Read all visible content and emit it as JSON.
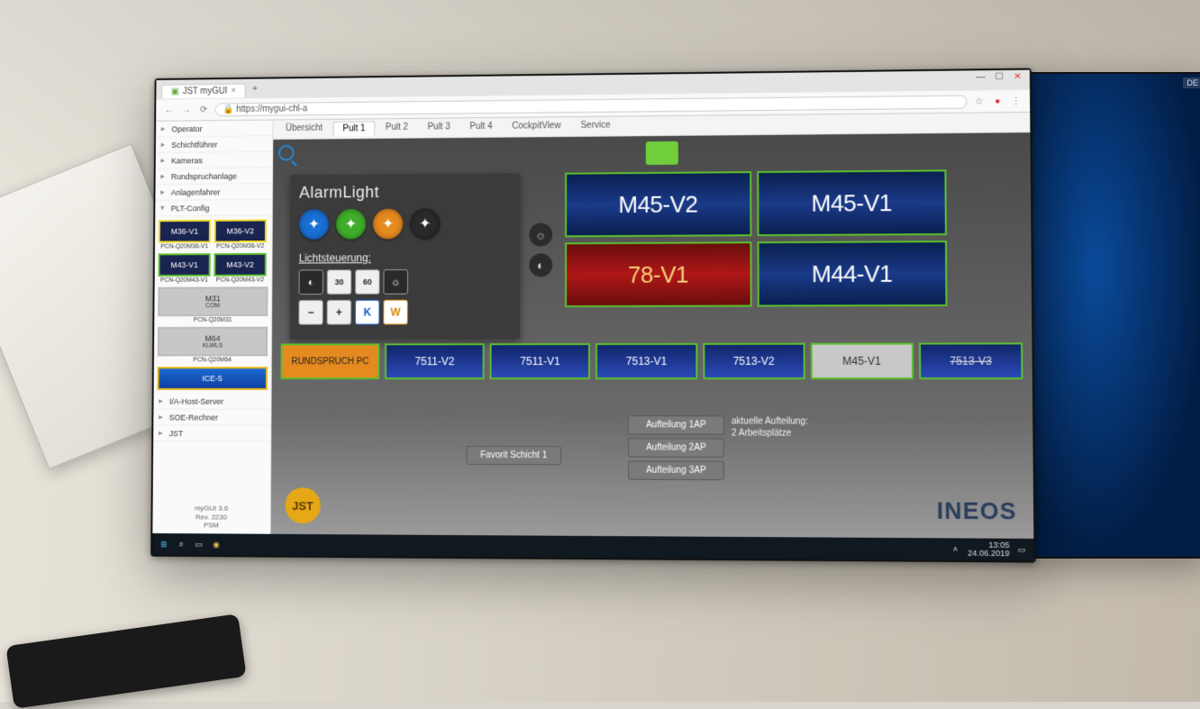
{
  "browser": {
    "tab_title": "JST myGUI",
    "url": "https://mygui-chl-a",
    "window_buttons": {
      "min": "—",
      "max": "☐",
      "close": "✕"
    }
  },
  "sidebar": {
    "items": [
      {
        "label": "Operator"
      },
      {
        "label": "Schichtführer"
      },
      {
        "label": "Kameras"
      },
      {
        "label": "Rundspruchanlage"
      },
      {
        "label": "Anlagenfahrer"
      },
      {
        "label": "PLT-Config"
      }
    ],
    "thumbs": [
      {
        "label": "M36-V1",
        "cap": "PCN-Q20M36-V1",
        "sel": true
      },
      {
        "label": "M36-V2",
        "cap": "PCN-Q20M36-V2",
        "sel": true
      },
      {
        "label": "M43-V1",
        "cap": "PCN-Q20M43-V1",
        "sel": false
      },
      {
        "label": "M43-V2",
        "cap": "PCN-Q20M43-V2",
        "sel": false
      }
    ],
    "singles": [
      {
        "label": "M31",
        "cap": "PCN-Q20M31",
        "sub": "COM"
      },
      {
        "label": "M64",
        "cap": "PCN-Q20M64",
        "sub": "KLWLS"
      }
    ],
    "ice": {
      "label": "ICE-5"
    },
    "footer_items": [
      "I/A-Host-Server",
      "SOE-Rechner",
      "JST"
    ],
    "footer": "myGUI 3.6\nRev. 2230\nPSM"
  },
  "tabs": [
    "Übersicht",
    "Pult 1",
    "Pult 2",
    "Pult 3",
    "Pult 4",
    "CockpitView",
    "Service"
  ],
  "active_tab": 1,
  "panel": {
    "alarm_title": "AlarmLight",
    "alarm_colors": [
      "#1a6fd4",
      "#3fae2a",
      "#e58a1e",
      "#2a2a2a"
    ],
    "licht_title": "Lichtsteuerung:",
    "row1": [
      "◐",
      "30",
      "60",
      "☼"
    ],
    "row2": [
      "−",
      "+",
      "K",
      "W"
    ]
  },
  "side_ctrl": [
    "☼",
    "◐"
  ],
  "wall": [
    {
      "label": "M45-V2"
    },
    {
      "label": "M45-V1"
    },
    {
      "label": "78-V1",
      "red": true
    },
    {
      "label": "M44-V1"
    }
  ],
  "desk": [
    {
      "label": "RUNDSPRUCH PC",
      "cls": "orange"
    },
    {
      "label": "7511-V2"
    },
    {
      "label": "7511-V1"
    },
    {
      "label": "7513-V1"
    },
    {
      "label": "7513-V2"
    },
    {
      "label": "M45-V1",
      "cls": "gray"
    },
    {
      "label": "7513-V3",
      "cls": "strike"
    }
  ],
  "lower_buttons": [
    "Aufteilung 1AP",
    "Aufteilung 2AP",
    "Aufteilung 3AP"
  ],
  "fav_button": "Favorit Schicht 1",
  "status": {
    "l1": "aktuelle Aufteilung:",
    "l2": "2 Arbeitsplätze"
  },
  "logos": {
    "jst": "JST",
    "ineos": "INEOS"
  },
  "taskbar": {
    "time": "13:05",
    "date": "24.06.2019",
    "lang": "DE"
  }
}
